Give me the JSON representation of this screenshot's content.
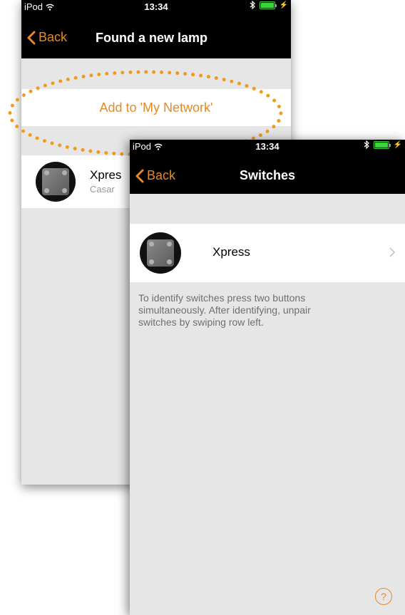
{
  "back_screen": {
    "status": {
      "carrier": "iPod",
      "time": "13:34"
    },
    "nav": {
      "back_label": "Back",
      "title": "Found a new lamp"
    },
    "add_button_label": "Add to 'My Network'",
    "device": {
      "name": "Xpres",
      "subtitle": "Casar"
    }
  },
  "front_screen": {
    "status": {
      "carrier": "iPod",
      "time": "13:34"
    },
    "nav": {
      "back_label": "Back",
      "title": "Switches"
    },
    "device": {
      "name": "Xpress"
    },
    "hint": "To identify switches press two buttons simultaneously. After identifying, unpair switches by swiping row left.",
    "help_label": "?"
  },
  "colors": {
    "accent": "#e58a27",
    "highlight": "#f29a1c",
    "battery": "#3cd23c"
  },
  "icons": [
    "wifi-icon",
    "bluetooth-icon",
    "battery-icon",
    "chevron-left-icon",
    "chevron-right-icon",
    "help-icon"
  ]
}
